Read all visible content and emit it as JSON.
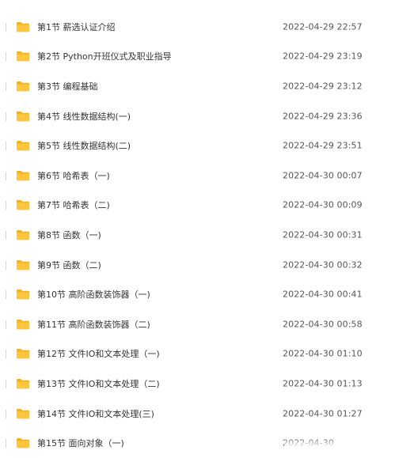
{
  "files": [
    {
      "name": "第1节 薪选认证介绍",
      "date": "2022-04-29 22:57"
    },
    {
      "name": "第2节 Python开班仪式及职业指导",
      "date": "2022-04-29 23:19"
    },
    {
      "name": "第3节 编程基础",
      "date": "2022-04-29 23:12"
    },
    {
      "name": "第4节 线性数据结构(一)",
      "date": "2022-04-29 23:36"
    },
    {
      "name": "第5节 线性数据结构(二)",
      "date": "2022-04-29 23:51"
    },
    {
      "name": "第6节 哈希表（一)",
      "date": "2022-04-30 00:07"
    },
    {
      "name": "第7节 哈希表（二)",
      "date": "2022-04-30 00:09"
    },
    {
      "name": "第8节 函数（一)",
      "date": "2022-04-30 00:31"
    },
    {
      "name": "第9节 函数（二)",
      "date": "2022-04-30 00:32"
    },
    {
      "name": "第10节 高阶函数装饰器（一)",
      "date": "2022-04-30 00:41"
    },
    {
      "name": "第11节 高阶函数装饰器（二)",
      "date": "2022-04-30 00:58"
    },
    {
      "name": "第12节 文件IO和文本处理（一)",
      "date": "2022-04-30 01:10"
    },
    {
      "name": "第13节 文件IO和文本处理（二)",
      "date": "2022-04-30 01:13"
    },
    {
      "name": "第14节 文件IO和文本处理(三)",
      "date": "2022-04-30 01:27"
    },
    {
      "name": "第15节 面向对象（一)",
      "date": "2022-04-30"
    }
  ],
  "colors": {
    "folder": "#ffc53d",
    "folder_tab": "#f5b21f",
    "text": "#333333",
    "date_text": "#555555"
  },
  "icon": "folder-icon"
}
